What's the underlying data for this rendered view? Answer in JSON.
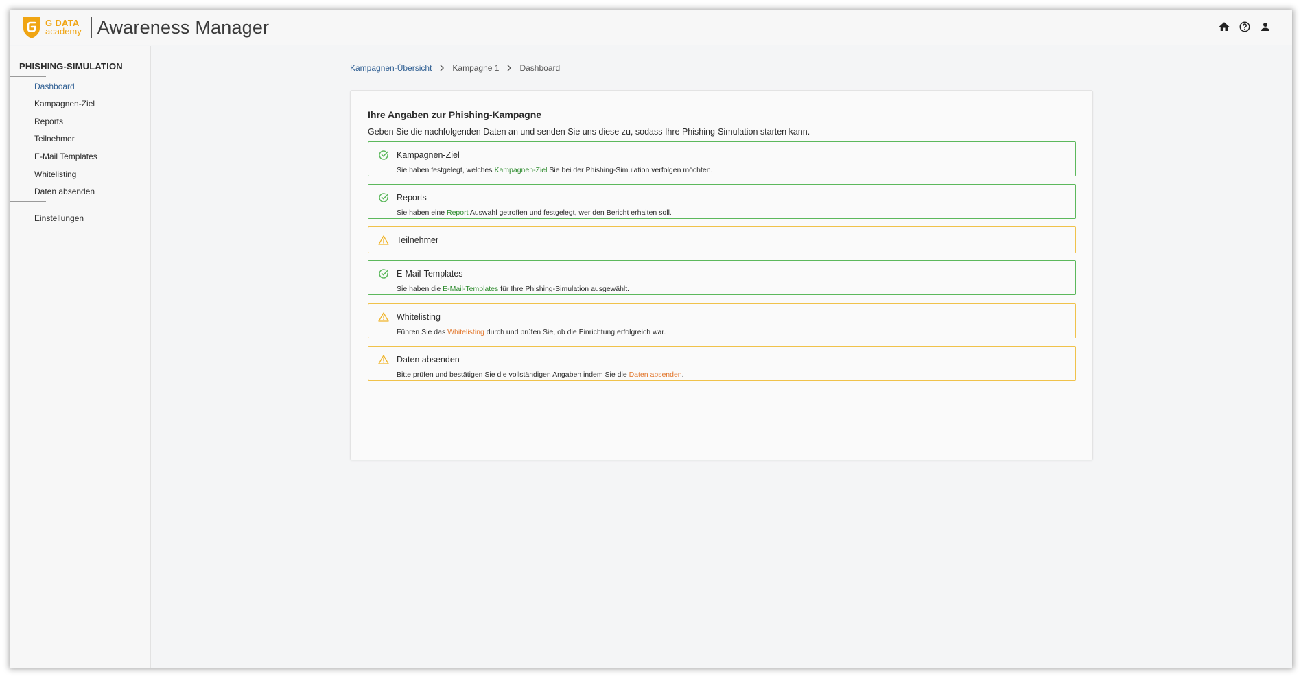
{
  "app": {
    "brand_line1": "G DATA",
    "brand_line2": "academy",
    "title": "Awareness Manager",
    "accent_color": "#f0a513"
  },
  "topbar": {
    "icons": [
      "home-icon",
      "help-icon",
      "user-icon"
    ]
  },
  "sidebar": {
    "section_title": "PHISHING-SIMULATION",
    "items": [
      {
        "label": "Dashboard",
        "active": true
      },
      {
        "label": "Kampagnen-Ziel"
      },
      {
        "label": "Reports"
      },
      {
        "label": "Teilnehmer"
      },
      {
        "label": "E-Mail Templates"
      },
      {
        "label": "Whitelisting"
      },
      {
        "label": "Daten absenden"
      }
    ],
    "settings_label": "Einstellungen"
  },
  "breadcrumb": {
    "items": [
      "Kampagnen-Übersicht",
      "Kampagne 1",
      "Dashboard"
    ]
  },
  "card": {
    "title": "Ihre Angaben zur Phishing-Kampagne",
    "subtitle": "Geben Sie die nachfolgenden Daten an und senden Sie uns diese zu, sodass Ihre Phishing-Simulation starten kann.",
    "steps": [
      {
        "status": "ok",
        "title": "Kampagnen-Ziel",
        "desc_pre": "Sie haben festgelegt, welches ",
        "desc_link": "Kampagnen-Ziel",
        "desc_post": " Sie bei der Phishing-Simulation verfolgen möchten."
      },
      {
        "status": "ok",
        "title": "Reports",
        "desc_pre": "Sie haben eine ",
        "desc_link": "Report",
        "desc_post": " Auswahl getroffen und festgelegt, wer den Bericht erhalten soll."
      },
      {
        "status": "warn",
        "title": "Teilnehmer"
      },
      {
        "status": "ok",
        "title": "E-Mail-Templates",
        "desc_pre": "Sie haben die ",
        "desc_link": "E-Mail-Templates",
        "desc_post": " für Ihre Phishing-Simulation ausgewählt."
      },
      {
        "status": "warn",
        "title": "Whitelisting",
        "desc_pre": "Führen Sie das ",
        "desc_link": "Whitelisting",
        "desc_post": " durch und prüfen Sie, ob die Einrichtung erfolgreich war."
      },
      {
        "status": "warn",
        "title": "Daten absenden",
        "desc_pre": "Bitte prüfen und bestätigen Sie die vollständigen Angaben indem Sie die ",
        "desc_link": "Daten absenden",
        "desc_post": "."
      }
    ]
  },
  "colors": {
    "ok": "#5cb85c",
    "warn": "#f0c24b",
    "link": "#2f5f93"
  }
}
